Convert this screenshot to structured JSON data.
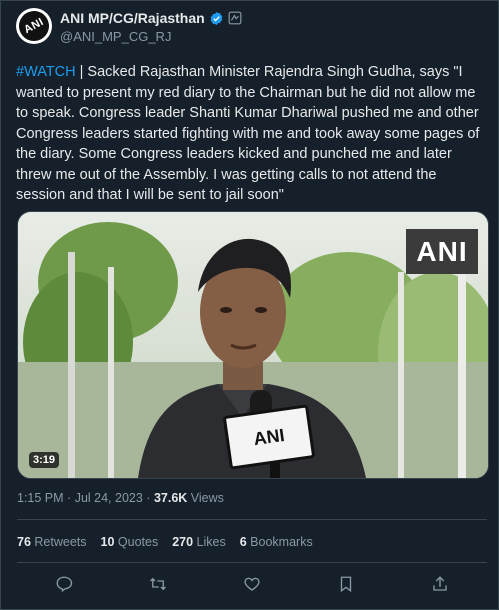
{
  "account": {
    "display_name": "ANI MP/CG/Rajasthan",
    "handle": "@ANI_MP_CG_RJ",
    "avatar_text": "ANI"
  },
  "tweet": {
    "hashtag": "#WATCH",
    "body": " | Sacked Rajasthan Minister Rajendra Singh Gudha, says \"I wanted to present my red diary to the Chairman but he did not allow me to speak. Congress leader Shanti Kumar Dhariwal pushed me and other Congress leaders started fighting with me and took away some pages of the diary. Some Congress leaders kicked and punched me and later threw me out of the Assembly. I was getting calls to not attend the session and that I will be sent to jail soon\""
  },
  "video": {
    "duration": "3:19",
    "watermark": "ANI",
    "mic_label": "ANI"
  },
  "meta": {
    "time": "1:15 PM",
    "separator": "·",
    "date": "Jul 24, 2023",
    "views_count": "37.6K",
    "views_label": "Views"
  },
  "stats": {
    "retweets_count": "76",
    "retweets_label": "Retweets",
    "quotes_count": "10",
    "quotes_label": "Quotes",
    "likes_count": "270",
    "likes_label": "Likes",
    "bookmarks_count": "6",
    "bookmarks_label": "Bookmarks"
  },
  "actions": [
    "reply-icon",
    "retweet-icon",
    "like-icon",
    "bookmark-icon",
    "share-icon"
  ],
  "colors": {
    "background": "#15202b",
    "accent": "#1d9bf0",
    "secondary_text": "#8b98a5",
    "border": "#38444d"
  }
}
